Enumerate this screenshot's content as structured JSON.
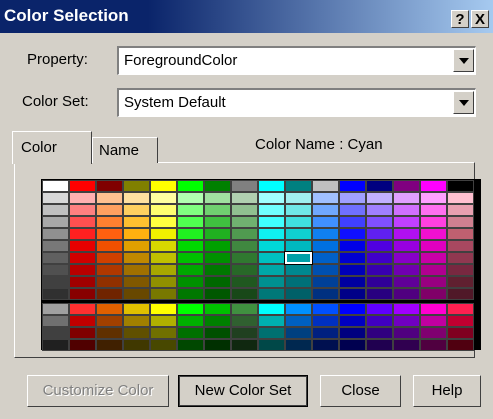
{
  "window": {
    "title": "Color Selection",
    "help_button": "?",
    "close_button": "X"
  },
  "property": {
    "label": "Property:",
    "value": "ForegroundColor"
  },
  "color_set": {
    "label": "Color Set:",
    "value": "System Default"
  },
  "tabs": [
    {
      "label": "Color",
      "selected": true
    },
    {
      "label": "Name",
      "selected": false
    }
  ],
  "color_name_text": "Color Name : Cyan",
  "palette": {
    "header_row": [
      "#ffffff",
      "#ff0000",
      "#800000",
      "#808000",
      "#ffff00",
      "#00ff00",
      "#008000",
      "#808080",
      "#00ffff",
      "#008080",
      "#c0c0c0",
      "#0000ff",
      "#000080",
      "#800080",
      "#ff00ff",
      "#000000"
    ],
    "rows": [
      [
        "#d8d8d8",
        "#ffb0b0",
        "#ffc090",
        "#ffe0a0",
        "#ffffa0",
        "#b0ffb0",
        "#a0e0a0",
        "#b0d0b0",
        "#a0ffff",
        "#a0f0f0",
        "#a0c0ff",
        "#a0a0ff",
        "#c0b0ff",
        "#e0a0ff",
        "#ffa0ff",
        "#ffc0d0"
      ],
      [
        "#c0c0c0",
        "#ff8080",
        "#ffa060",
        "#ffd060",
        "#ffff70",
        "#80ff80",
        "#70d070",
        "#90c090",
        "#70ffff",
        "#70e8e8",
        "#70a8ff",
        "#7070ff",
        "#a080ff",
        "#d070ff",
        "#ff70f0",
        "#e8a0b0"
      ],
      [
        "#a8a8a8",
        "#ff5050",
        "#ff8030",
        "#ffc030",
        "#ffff40",
        "#50ff50",
        "#40c040",
        "#70b070",
        "#40ffff",
        "#40e0e0",
        "#4090ff",
        "#4040ff",
        "#8050ff",
        "#c040ff",
        "#ff40e0",
        "#d08090"
      ],
      [
        "#909090",
        "#ff2020",
        "#ff6010",
        "#ffb010",
        "#f0f000",
        "#20f020",
        "#20b020",
        "#509a50",
        "#10f0f0",
        "#10d0d0",
        "#1080f0",
        "#1010ff",
        "#6020f0",
        "#b010f0",
        "#f010d0",
        "#c06070"
      ],
      [
        "#787878",
        "#e80000",
        "#f05000",
        "#e0a000",
        "#d8d800",
        "#00d800",
        "#00a000",
        "#408840",
        "#00d8d8",
        "#00b8c0",
        "#0070e0",
        "#0000e8",
        "#5000e0",
        "#9800e0",
        "#e000c0",
        "#a84860"
      ],
      [
        "#606060",
        "#d00000",
        "#d04000",
        "#c08800",
        "#c0c000",
        "#00c000",
        "#009000",
        "#307830",
        "#00c0c0",
        "#00a0a8",
        "#0060c8",
        "#0000d0",
        "#4000c8",
        "#8800c8",
        "#c800a8",
        "#903850"
      ],
      [
        "#505050",
        "#b80000",
        "#b03800",
        "#a07000",
        "#a8a800",
        "#00a800",
        "#007800",
        "#286828",
        "#00a8a8",
        "#008890",
        "#0050b0",
        "#0000b8",
        "#3800b0",
        "#7000b0",
        "#b00090",
        "#782840"
      ],
      [
        "#404040",
        "#a00000",
        "#903000",
        "#805800",
        "#909000",
        "#009000",
        "#006800",
        "#205820",
        "#009090",
        "#007078",
        "#004098",
        "#0000a0",
        "#300098",
        "#600098",
        "#980080",
        "#602030"
      ],
      [
        "#303030",
        "#880000",
        "#702400",
        "#684800",
        "#787800",
        "#007800",
        "#005800",
        "#184818",
        "#007878",
        "#006068",
        "#003080",
        "#000088",
        "#280080",
        "#500080",
        "#800068",
        "#501828"
      ],
      [
        "#a0a0a0",
        "#ff3030",
        "#e06000",
        "#e0c000",
        "#ffff00",
        "#00ff00",
        "#00c000",
        "#409040",
        "#00ffff",
        "#0090ff",
        "#0050ff",
        "#0000ff",
        "#6000ff",
        "#a000ff",
        "#ff00d0",
        "#ff2050"
      ],
      [
        "#707070",
        "#c00000",
        "#a04000",
        "#a08000",
        "#b0b000",
        "#00b000",
        "#008000",
        "#306030",
        "#00b0b0",
        "#0060c0",
        "#0030c0",
        "#0000c0",
        "#4000c0",
        "#7000c0",
        "#c000a0",
        "#c00030"
      ],
      [
        "#404040",
        "#800000",
        "#603000",
        "#605000",
        "#707000",
        "#007000",
        "#005000",
        "#204020",
        "#007070",
        "#004080",
        "#002080",
        "#000080",
        "#300080",
        "#500080",
        "#800070",
        "#800020"
      ],
      [
        "#202020",
        "#500000",
        "#402000",
        "#403800",
        "#484800",
        "#004800",
        "#003000",
        "#102810",
        "#004848",
        "#002850",
        "#001050",
        "#000050",
        "#200050",
        "#300050",
        "#500040",
        "#500010"
      ]
    ],
    "selected": {
      "row": 5,
      "col": 9
    }
  },
  "buttons": {
    "customize": "Customize Color",
    "new_set": "New Color Set",
    "close": "Close",
    "help": "Help"
  }
}
